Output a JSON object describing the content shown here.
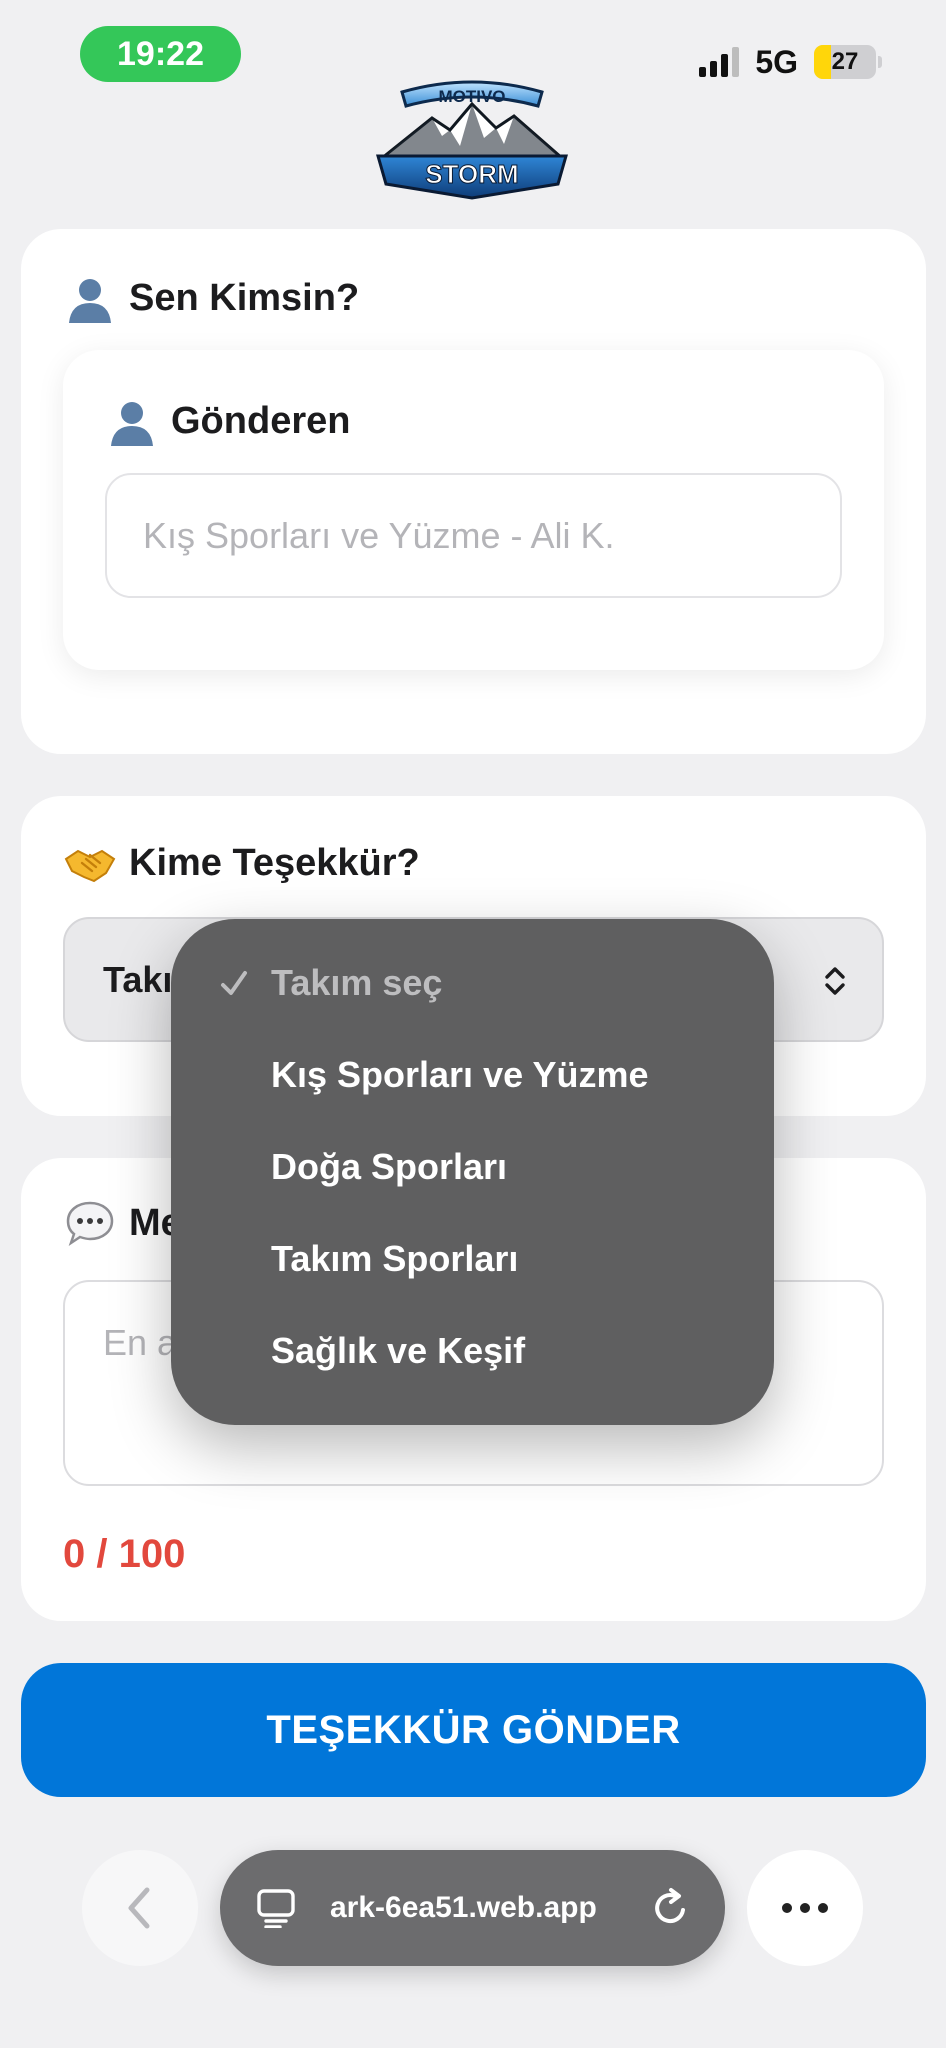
{
  "status_bar": {
    "time": "19:22",
    "network": "5G",
    "battery": "27",
    "battery_level": 0.27
  },
  "logo": {
    "top_text": "MOTIVO",
    "bottom_text": "STORM"
  },
  "sender_section": {
    "title": "Sen Kimsin?",
    "icon": "user-silhouette-icon",
    "field_label": "Gönderen",
    "field_placeholder": "Kış Sporları ve Yüzme - Ali K.",
    "field_value": ""
  },
  "recipient_section": {
    "title": "Kime Teşekkür?",
    "icon": "handshake-icon",
    "select_value_partial": "Takı"
  },
  "message_section": {
    "title_partial": "Me",
    "icon": "speech-bubble-icon",
    "placeholder_partial": "En a",
    "counter": "0 / 100"
  },
  "submit": {
    "label": "TEŞEKKÜR GÖNDER"
  },
  "dropdown": {
    "options": [
      {
        "label": "Takım seç",
        "selected": true
      },
      {
        "label": "Kış Sporları ve Yüzme",
        "selected": false
      },
      {
        "label": "Doğa Sporları",
        "selected": false
      },
      {
        "label": "Takım Sporları",
        "selected": false
      },
      {
        "label": "Sağlık ve Keşif",
        "selected": false
      }
    ]
  },
  "browser": {
    "url_visible": "ark-6ea51.web.app"
  },
  "colors": {
    "primary": "#0176d9",
    "counter_red": "#e2483d",
    "status_green": "#34c759",
    "menu_bg": "#5f5f60"
  }
}
